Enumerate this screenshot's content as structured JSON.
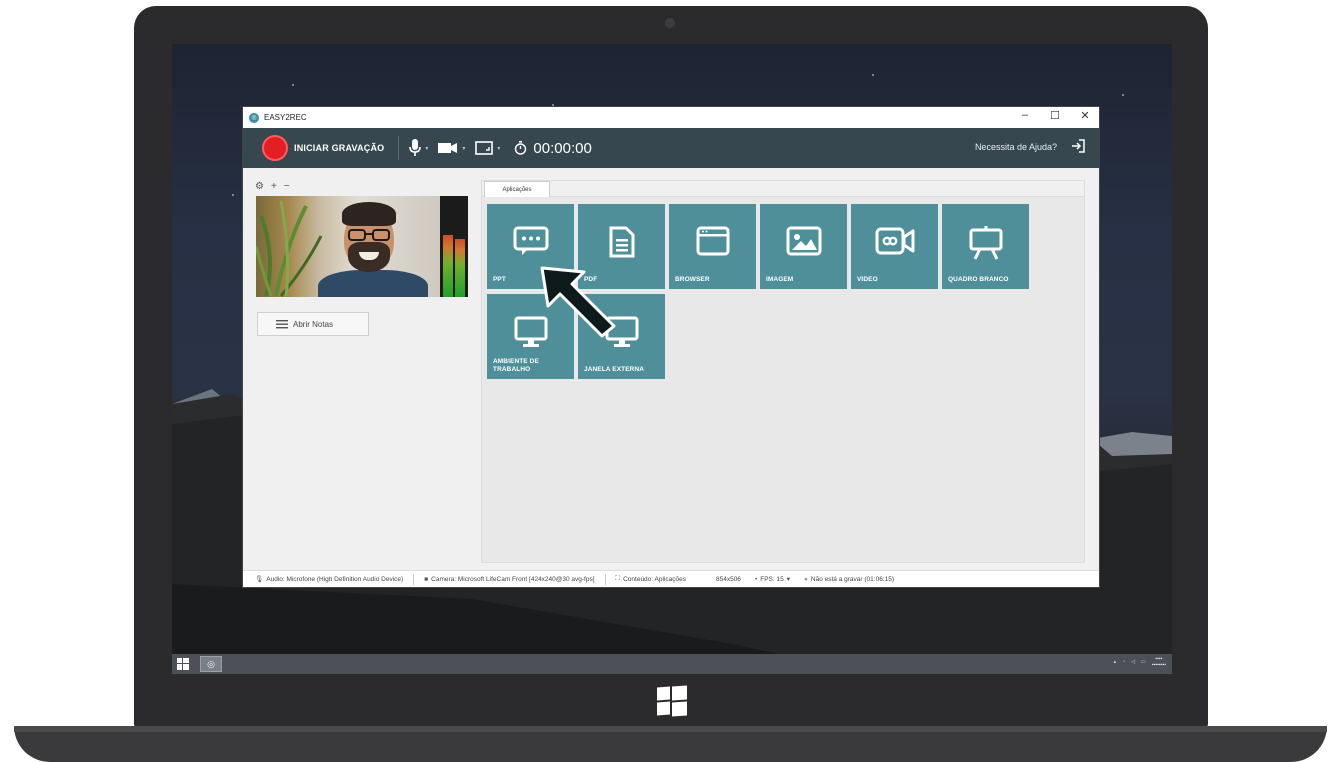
{
  "window": {
    "title": "EASY2REC"
  },
  "toolbar": {
    "record_label": "INICIAR GRAVAÇÃO",
    "timer": "00:00:00",
    "help_label": "Necessita de Ajuda?"
  },
  "left_panel": {
    "notes_button": "Abrir Notas"
  },
  "content": {
    "tab_label": "Aplicações",
    "tiles": [
      {
        "label": "PPT",
        "icon": "chat-bubble-icon"
      },
      {
        "label": "PDF",
        "icon": "document-icon"
      },
      {
        "label": "BROWSER",
        "icon": "browser-window-icon"
      },
      {
        "label": "IMAGEM",
        "icon": "image-icon"
      },
      {
        "label": "VIDEO",
        "icon": "video-camera-icon"
      },
      {
        "label": "QUADRO BRANCO",
        "icon": "whiteboard-icon"
      },
      {
        "label": "AMBIENTE DE TRABALHO",
        "icon": "monitor-icon"
      },
      {
        "label": "JANELA EXTERNA",
        "icon": "monitor-icon"
      }
    ]
  },
  "statusbar": {
    "audio": "Audio: Microfone (High Definition Audio Device)",
    "camera": "Camera: Microsoft LifeCam Front [424x240@30 avg-fps]",
    "content": "Conteúdo: Aplicações",
    "resolution": "854x506",
    "fps": "FPS: 15",
    "recording_status": "Não está a gravar (01:06:15)"
  },
  "colors": {
    "toolbar_bg": "#37474f",
    "tile_bg": "#4e8f9a",
    "record_red": "#e31e24"
  }
}
